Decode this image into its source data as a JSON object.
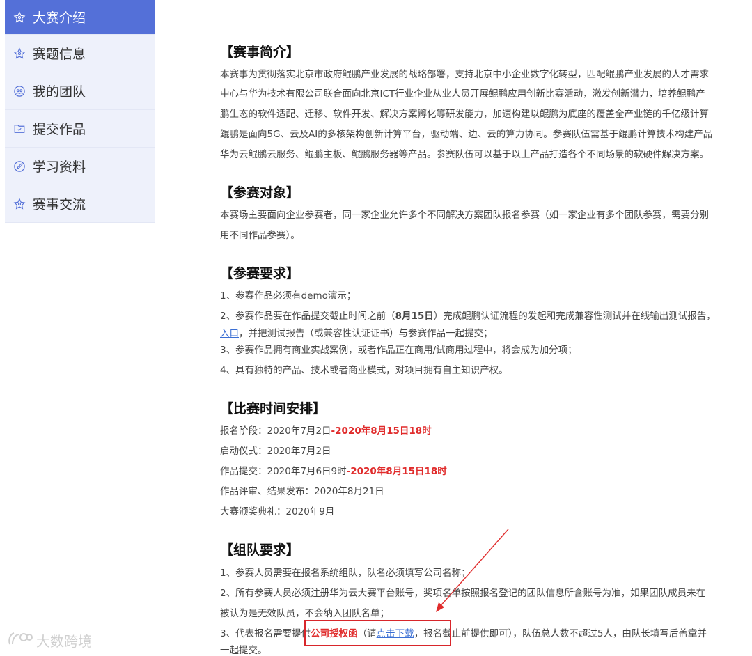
{
  "sidebar": {
    "items": [
      {
        "label": "大赛介绍",
        "icon": "star-icon",
        "active": true
      },
      {
        "label": "赛题信息",
        "icon": "star-icon"
      },
      {
        "label": "我的团队",
        "icon": "team-icon"
      },
      {
        "label": "提交作品",
        "icon": "folder-icon"
      },
      {
        "label": "学习资料",
        "icon": "pen-icon"
      },
      {
        "label": "赛事交流",
        "icon": "star-icon"
      }
    ]
  },
  "intro": {
    "title": "【赛事简介】",
    "lines": [
      "本赛事为贯彻落实北京市政府鲲鹏产业发展的战略部署，支持北京中小企业数字化转型，匹配鲲鹏产业发展的人才需求",
      "中心与华为技术有限公司联合面向北京ICT行业企业从业人员开展鲲鹏应用创新比赛活动，激发创新潜力，培养鲲鹏产",
      "鹏生态的软件适配、迁移、软件开发、解决方案孵化等研发能力，加速构建以鲲鹏为底座的覆盖全产业链的千亿级计算",
      "鲲鹏是面向5G、云及AI的多核架构创新计算平台，驱动端、边、云的算力协同。参赛队伍需基于鲲鹏计算技术构建产品",
      "华为云鲲鹏云服务、鲲鹏主板、鲲鹏服务器等产品。参赛队伍可以基于以上产品打造各个不同场景的软硬件解决方案。"
    ]
  },
  "target": {
    "title": "【参赛对象】",
    "lines": [
      "本赛场主要面向企业参赛者，同一家企业允许多个不同解决方案团队报名参赛（如一家企业有多个团队参赛，需要分别",
      "用不同作品参赛）。"
    ]
  },
  "requirements": {
    "title": "【参赛要求】",
    "item1": "1、参赛作品必须有demo演示；",
    "item2_pre": "2、参赛作品要在作品提交截止时间之前（",
    "item2_bold": "8月15日",
    "item2_post": "）完成鲲鹏认证流程的发起和完成兼容性测试并在线输出测试报告，",
    "item2_link": "入口",
    "item2_tail": "，并把测试报告（或兼容性认证证书）与参赛作品一起提交；",
    "item3": "3、参赛作品拥有商业实战案例，或者作品正在商用/试商用过程中，将会成为加分项；",
    "item4": "4、具有独特的产品、技术或者商业模式，对项目拥有自主知识产权。"
  },
  "schedule": {
    "title": "【比赛时间安排】",
    "reg_label": "报名阶段：2020年7月2日",
    "reg_end": "-2020年8月15日18时",
    "launch": "启动仪式：2020年7月2日",
    "submit_label": "作品提交：2020年7月6日9时",
    "submit_end": "-2020年8月15日18时",
    "review": "作品评审、结果发布：2020年8月21日",
    "award": "大赛颁奖典礼：2020年9月"
  },
  "team": {
    "title": "【组队要求】",
    "item1": "1、参赛人员需要在报名系统组队，队名必须填写公司名称；",
    "item2": "2、所有参赛人员必须注册华为云大赛平台账号，奖项名单按照报名登记的团队信息所含账号为准，如果团队成员未在",
    "item2b": "被认为是无效队员，不会纳入团队名单；",
    "item3_pre": "3、代表报名需要提供",
    "item3_red": "公司授权函",
    "item3_mid": "（请",
    "item3_link": "点击下载",
    "item3_post": "，报名截止前提供即可），队伍总人数不超过5人，由队长填写后盖章并",
    "item3b": "一起提交。"
  },
  "watermark": "大数跨境",
  "colors": {
    "accent": "#5470d8",
    "red": "#e02b2b",
    "link": "#3b6fd4",
    "sidebar_bg": "#eef1fb"
  }
}
